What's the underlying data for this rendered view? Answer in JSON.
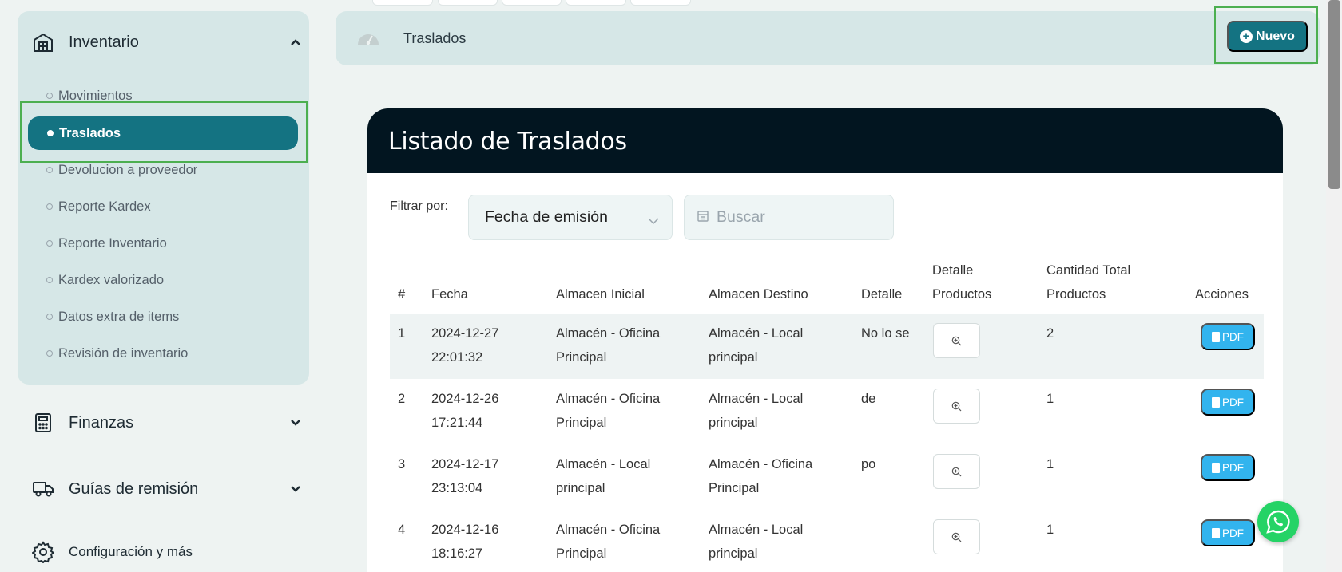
{
  "sidebar": {
    "group": {
      "label": "Inventario",
      "icon": "warehouse-icon",
      "expanded": true,
      "items": [
        {
          "label": "Movimientos",
          "active": false
        },
        {
          "label": "Traslados",
          "active": true
        },
        {
          "label": "Devolucion a proveedor",
          "active": false
        },
        {
          "label": "Reporte Kardex",
          "active": false
        },
        {
          "label": "Reporte Inventario",
          "active": false
        },
        {
          "label": "Kardex valorizado",
          "active": false
        },
        {
          "label": "Datos extra de items",
          "active": false
        },
        {
          "label": "Revisión de inventario",
          "active": false
        }
      ]
    },
    "nav": [
      {
        "label": "Finanzas",
        "icon": "calculator-icon"
      },
      {
        "label": "Guías de remisión",
        "icon": "truck-icon"
      },
      {
        "label": "Configuración y más",
        "icon": "gear-icon"
      }
    ]
  },
  "header": {
    "title": "Traslados",
    "icon": "dashboard-icon",
    "new_button": "Nuevo"
  },
  "card": {
    "title": "Listado de Traslados",
    "filter_label": "Filtrar por:",
    "filter_select": "Fecha de emisión",
    "search_placeholder": "Buscar"
  },
  "table": {
    "headers": {
      "num": "#",
      "fecha": "Fecha",
      "almacen_inicial": "Almacen Inicial",
      "almacen_destino": "Almacen Destino",
      "detalle": "Detalle",
      "detalle_productos_1": "Detalle",
      "detalle_productos_2": "Productos",
      "cantidad_1": "Cantidad Total",
      "cantidad_2": "Productos",
      "acciones": "Acciones"
    },
    "rows": [
      {
        "num": "1",
        "fecha_1": "2024-12-27",
        "fecha_2": "22:01:32",
        "inicial_1": "Almacén - Oficina",
        "inicial_2": "Principal",
        "destino_1": "Almacén - Local",
        "destino_2": "principal",
        "detalle": "No lo se",
        "cantidad": "2",
        "action": "PDF"
      },
      {
        "num": "2",
        "fecha_1": "2024-12-26",
        "fecha_2": "17:21:44",
        "inicial_1": "Almacén - Oficina",
        "inicial_2": "Principal",
        "destino_1": "Almacén - Local",
        "destino_2": "principal",
        "detalle": "de",
        "cantidad": "1",
        "action": "PDF"
      },
      {
        "num": "3",
        "fecha_1": "2024-12-17",
        "fecha_2": "23:13:04",
        "inicial_1": "Almacén - Local",
        "inicial_2": "principal",
        "destino_1": "Almacén - Oficina",
        "destino_2": "Principal",
        "detalle": "po",
        "cantidad": "1",
        "action": "PDF"
      },
      {
        "num": "4",
        "fecha_1": "2024-12-16",
        "fecha_2": "18:16:27",
        "inicial_1": "Almacén - Oficina",
        "inicial_2": "Principal",
        "destino_1": "Almacén - Local",
        "destino_2": "principal",
        "detalle": "",
        "cantidad": "1",
        "action": "PDF"
      }
    ]
  },
  "colors": {
    "accent": "#147382",
    "card_header": "#021520",
    "pdf": "#32b4ee",
    "highlight": "#4caf50"
  }
}
